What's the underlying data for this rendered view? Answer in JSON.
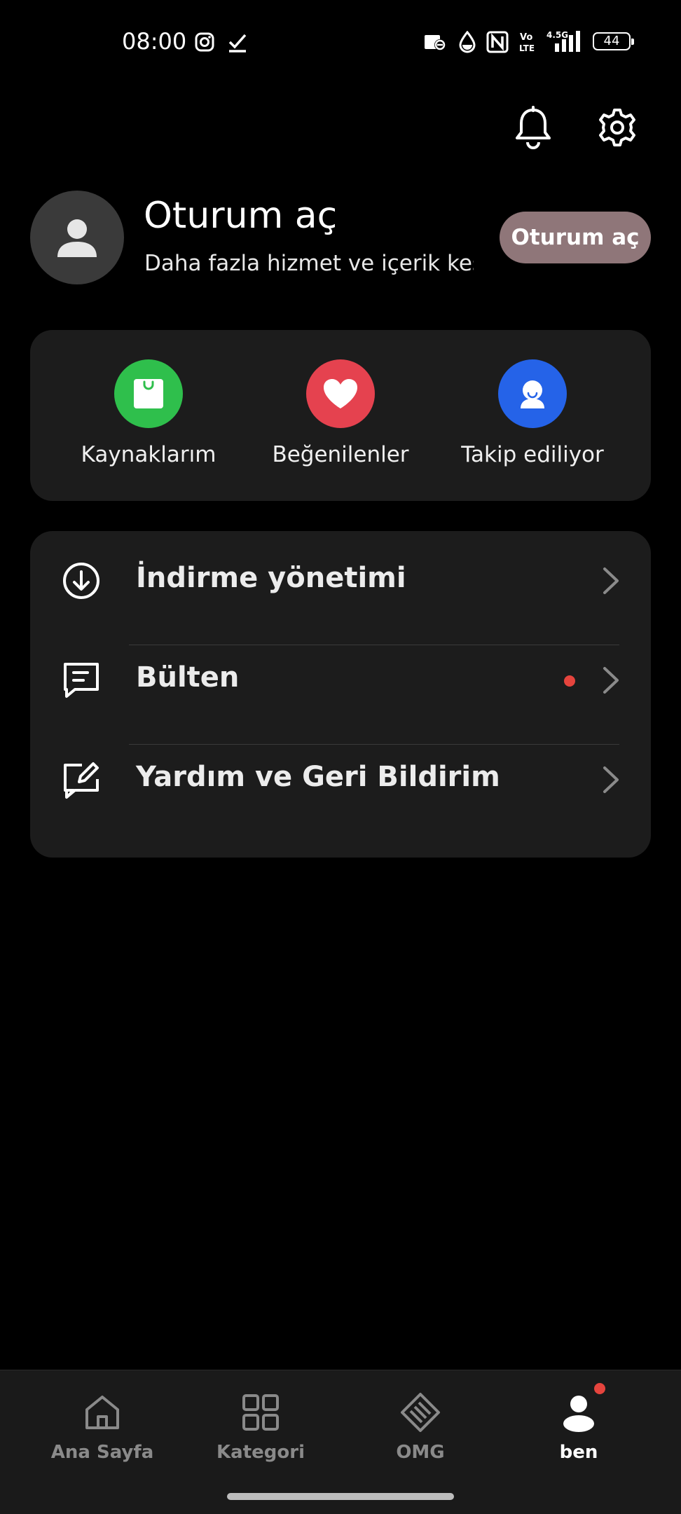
{
  "status_bar": {
    "time": "08:00",
    "battery": "44",
    "network": "4.5G",
    "icons": [
      "instagram-icon",
      "check-icon",
      "data-saver-icon",
      "drop-icon",
      "nfc-icon",
      "volte-icon",
      "signal-icon",
      "battery-icon"
    ]
  },
  "header": {
    "icons": [
      "bell-icon",
      "gear-icon"
    ]
  },
  "profile": {
    "title": "Oturum aç",
    "subtitle": "Daha fazla hizmet ve içerik keş…",
    "login_button": "Oturum aç",
    "avatar_icon": "user-icon"
  },
  "quick_actions": [
    {
      "label": "Kaynaklarım",
      "icon": "shopping-bag-icon",
      "color": "#2fbf4c"
    },
    {
      "label": "Beğenilenler",
      "icon": "heart-icon",
      "color": "#e5424f"
    },
    {
      "label": "Takip ediliyor",
      "icon": "follow-icon",
      "color": "#2563e8"
    }
  ],
  "menu": [
    {
      "label": "İndirme yönetimi",
      "icon": "download-icon",
      "has_dot": false
    },
    {
      "label": "Bülten",
      "icon": "message-icon",
      "has_dot": true
    },
    {
      "label": "Yardım ve Geri Bildirim",
      "icon": "feedback-edit-icon",
      "has_dot": false
    }
  ],
  "bottom_nav": [
    {
      "label": "Ana Sayfa",
      "icon": "home-icon",
      "active": false
    },
    {
      "label": "Kategori",
      "icon": "grid-icon",
      "active": false
    },
    {
      "label": "OMG",
      "icon": "tag-icon",
      "active": false
    },
    {
      "label": "ben",
      "icon": "person-icon",
      "active": true,
      "has_dot": true
    }
  ],
  "colors": {
    "background": "#000000",
    "card": "#1c1c1c",
    "login_button": "#8f7679",
    "notification_dot": "#e5443d"
  }
}
